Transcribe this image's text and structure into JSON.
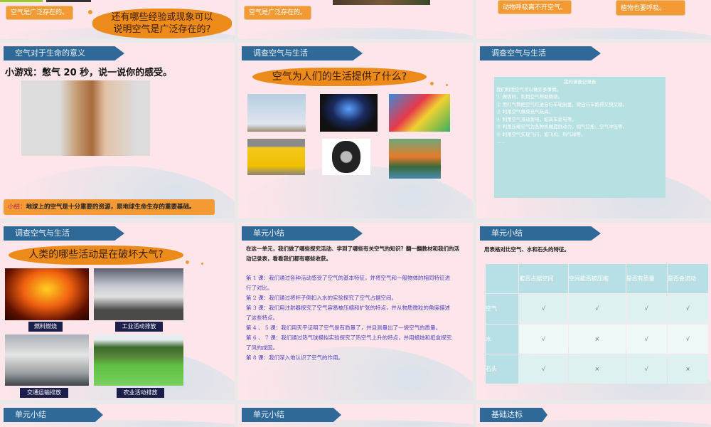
{
  "row0": {
    "s1_label": "空气是广泛存在的。",
    "s1_cloud": "还有哪些经验或现象可以说明空气是广泛存在的?",
    "s2_label": "空气是广泛存在的。",
    "s3_label_a": "动物呼吸离不开空气。",
    "s3_label_b": "植物也要呼吸。"
  },
  "slide_life": {
    "header": "空气对于生命的意义",
    "prompt": "小游戏：憋气 20 秒，说一说你的感受。",
    "summary_prefix": "小结：",
    "summary": "地球上的空气是十分重要的资源，是地球生命生存的重要基础。"
  },
  "slide_uses": {
    "header": "调查空气与生活",
    "question": "空气为人们的生活提供了什么?"
  },
  "slide_record": {
    "header": "调查空气与生活",
    "title": "我的调查记录表",
    "lines": [
      "我们利用空气可以做许多事情。",
      "① 做饭时，利用空气帮助燃烧。",
      "② 用打气筒把空气打进自行车轮胎里，使自行车跑得又快又稳。",
      "③ 利用空气做成充气玩具。",
      "④ 利用空气流动发电，如风车发电等。",
      "⑤ 利用压缩空气为各种机械提供动力，如气钉枪、空气冲压等。",
      "⑥ 利用空气实现飞行，如飞机、热气球等。",
      "……"
    ]
  },
  "slide_damage": {
    "header": "调查空气与生活",
    "question": "人类的哪些活动是在破坏大气?",
    "captions": [
      "燃料燃烧",
      "工业活动排放",
      "交通运输排放",
      "农业活动排放"
    ]
  },
  "slide_summary": {
    "header": "单元小结",
    "intro": "在这一单元，我们做了哪些探究活动、学到了哪些有关空气的知识？翻一翻教材和我们的活动记录表，看看我们都有哪些收获。",
    "lessons": [
      "第 1 课：我们通过各种活动感受了空气的基本特征，并将空气和一般物体的相同特征进行了对比。",
      "第 2 课：我们通过将杯子倒扣入水的实验探究了空气占据空间。",
      "第 3 课：我们用注射器探究了空气容易被压缩和扩张的特点，并从物质微粒的角度描述了这些特点。",
      "第 4 、 5 课：我们用天平证明了空气是有质量了，并且测量出了一袋空气的质量。",
      "第 6 、 7 课：我们通过热气球模拟实验探究了热空气上升的特点，并用蜡烛和纸盒探究了风的成因。",
      "第 8 课：我们深入地认识了空气的作用。"
    ]
  },
  "slide_table": {
    "header": "单元小结",
    "intro": "用表格对比空气、水和石头的特征。",
    "columns": [
      "",
      "能否占据空间",
      "空间能否被压缩",
      "是否有质量",
      "是否会流动"
    ],
    "rows": [
      [
        "空气",
        "√",
        "√",
        "√",
        "√"
      ],
      [
        "水",
        "√",
        "×",
        "√",
        "√"
      ],
      [
        "石头",
        "√",
        "×",
        "√",
        "×"
      ]
    ]
  },
  "row3": {
    "h1": "单元小结",
    "h2": "单元小结",
    "h3": "基础达标"
  }
}
